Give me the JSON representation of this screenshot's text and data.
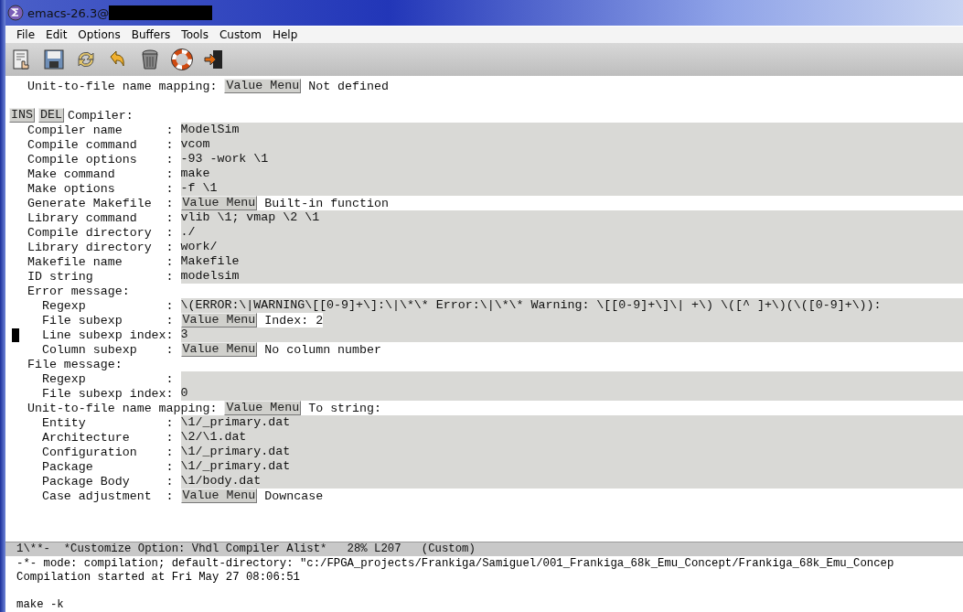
{
  "window": {
    "title": "emacs-26.3@"
  },
  "menu_bar": [
    "File",
    "Edit",
    "Options",
    "Buffers",
    "Tools",
    "Custom",
    "Help"
  ],
  "toolbar": [
    {
      "kind": "document"
    },
    {
      "kind": "save"
    },
    {
      "kind": "refresh"
    },
    {
      "kind": "undo"
    },
    {
      "kind": "trash"
    },
    {
      "kind": "help"
    },
    {
      "kind": "exit"
    }
  ],
  "buffer": [
    {
      "kind": "menu",
      "label": "  Unit-to-file name mapping: ",
      "button": "Value Menu",
      "value": "Not defined",
      "nested": false
    },
    {
      "kind": "blank"
    },
    {
      "kind": "insdel",
      "buttons": [
        "INS",
        "DEL"
      ],
      "label": "Compiler:"
    },
    {
      "kind": "field",
      "label": "  Compiler name      : ",
      "value": "ModelSim"
    },
    {
      "kind": "field",
      "label": "  Compile command    : ",
      "value": "vcom"
    },
    {
      "kind": "field",
      "label": "  Compile options    : ",
      "value": "-93 -work \\1"
    },
    {
      "kind": "field",
      "label": "  Make command       : ",
      "value": "make"
    },
    {
      "kind": "field",
      "label": "  Make options       : ",
      "value": "-f \\1"
    },
    {
      "kind": "menu",
      "label": "  Generate Makefile  : ",
      "button": "Value Menu",
      "value": "Built-in function",
      "nested": false
    },
    {
      "kind": "field",
      "label": "  Library command    : ",
      "value": "vlib \\1; vmap \\2 \\1"
    },
    {
      "kind": "field",
      "label": "  Compile directory  : ",
      "value": "./"
    },
    {
      "kind": "field",
      "label": "  Library directory  : ",
      "value": "work/"
    },
    {
      "kind": "field",
      "label": "  Makefile name      : ",
      "value": "Makefile"
    },
    {
      "kind": "field",
      "label": "  ID string          : ",
      "value": "modelsim"
    },
    {
      "kind": "heading",
      "label": "  Error message:"
    },
    {
      "kind": "field",
      "label": "    Regexp           : ",
      "value": "\\(ERROR:\\|WARNING\\[[0-9]+\\]:\\|\\*\\* Error:\\|\\*\\* Warning: \\[[0-9]+\\]\\| +\\) \\([^ ]+\\)(\\([0-9]+\\)):"
    },
    {
      "kind": "menu",
      "label": "    File subexp      : ",
      "button": "Value Menu",
      "value": "Index: 2",
      "nested": true
    },
    {
      "kind": "field",
      "label": "    Line subexp index: ",
      "value": "3",
      "cursor": true
    },
    {
      "kind": "menu",
      "label": "    Column subexp    : ",
      "button": "Value Menu",
      "value": "No column number",
      "nested": false
    },
    {
      "kind": "heading",
      "label": "  File message:"
    },
    {
      "kind": "field",
      "label": "    Regexp           : "
    },
    {
      "kind": "field",
      "label": "    File subexp index: ",
      "value": "0"
    },
    {
      "kind": "menu",
      "label": "  Unit-to-file name mapping: ",
      "button": "Value Menu",
      "value": "To string:",
      "nested": false
    },
    {
      "kind": "field",
      "label": "    Entity           : ",
      "value": "\\1/_primary.dat"
    },
    {
      "kind": "field",
      "label": "    Architecture     : ",
      "value": "\\2/\\1.dat"
    },
    {
      "kind": "field",
      "label": "    Configuration    : ",
      "value": "\\1/_primary.dat"
    },
    {
      "kind": "field",
      "label": "    Package          : ",
      "value": "\\1/_primary.dat"
    },
    {
      "kind": "field",
      "label": "    Package Body     : ",
      "value": "\\1/body.dat"
    },
    {
      "kind": "menu",
      "label": "    Case adjustment  : ",
      "button": "Value Menu",
      "value": "Downcase",
      "nested": false
    }
  ],
  "mode_line": "1\\**-  *Customize Option: Vhdl Compiler Alist*   28% L207   (Custom)",
  "compilation": [
    {
      "kind": "text",
      "text": "-*- mode: compilation; default-directory: \"c:/FPGA_projects/Frankiga/Samiguel/001_Frankiga_68k_Emu_Concept/Frankiga_68k_Emu_Concep"
    },
    {
      "kind": "text",
      "text": "Compilation started at Fri May 27 08:06:51"
    },
    {
      "kind": "blank"
    },
    {
      "kind": "text",
      "text": "make -k"
    }
  ]
}
